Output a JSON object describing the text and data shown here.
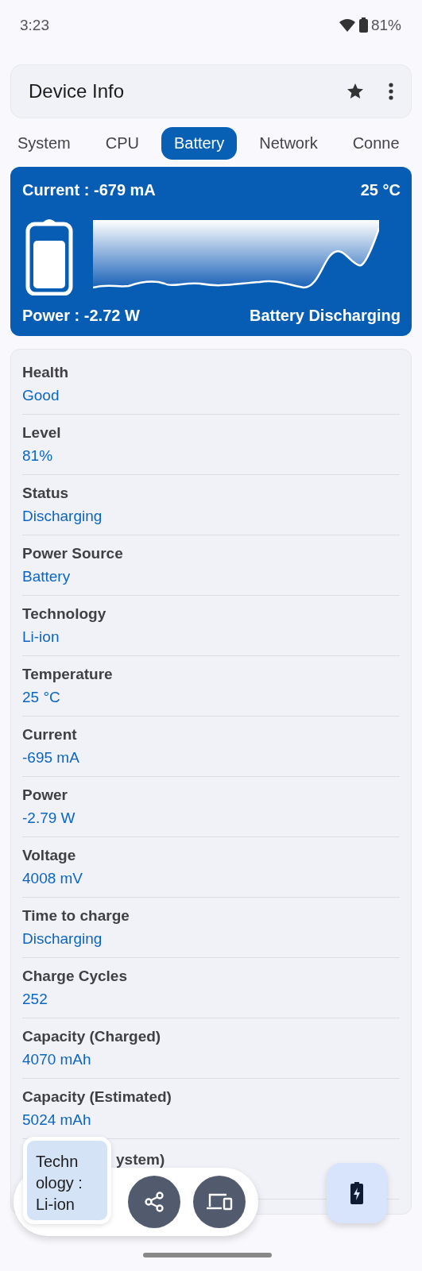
{
  "status_bar": {
    "time": "3:23",
    "battery": "81%"
  },
  "app_bar": {
    "title": "Device Info"
  },
  "tabs": [
    {
      "label": "System",
      "selected": false
    },
    {
      "label": "CPU",
      "selected": false
    },
    {
      "label": "Battery",
      "selected": true
    },
    {
      "label": "Network",
      "selected": false
    },
    {
      "label": "Conne",
      "selected": false
    }
  ],
  "battery_card": {
    "current": "Current : -679 mA",
    "temperature": "25 °C",
    "power": "Power : -2.72 W",
    "status": "Battery Discharging"
  },
  "details": [
    {
      "label": "Health",
      "value": "Good"
    },
    {
      "label": "Level",
      "value": "81%"
    },
    {
      "label": "Status",
      "value": "Discharging"
    },
    {
      "label": "Power Source",
      "value": "Battery"
    },
    {
      "label": "Technology",
      "value": "Li-ion"
    },
    {
      "label": "Temperature",
      "value": "25 °C"
    },
    {
      "label": "Current",
      "value": "-695 mA"
    },
    {
      "label": "Power",
      "value": "-2.79 W"
    },
    {
      "label": "Voltage",
      "value": "4008 mV"
    },
    {
      "label": "Time to charge",
      "value": "Discharging"
    },
    {
      "label": "Charge Cycles",
      "value": "252"
    },
    {
      "label": "Capacity (Charged)",
      "value": "4070 mAh"
    },
    {
      "label": "Capacity (Estimated)",
      "value": "5024 mAh"
    },
    {
      "label": "ystem)",
      "kind": "covered"
    }
  ],
  "tooltip": {
    "text": "Techn ology : Li-ion"
  }
}
